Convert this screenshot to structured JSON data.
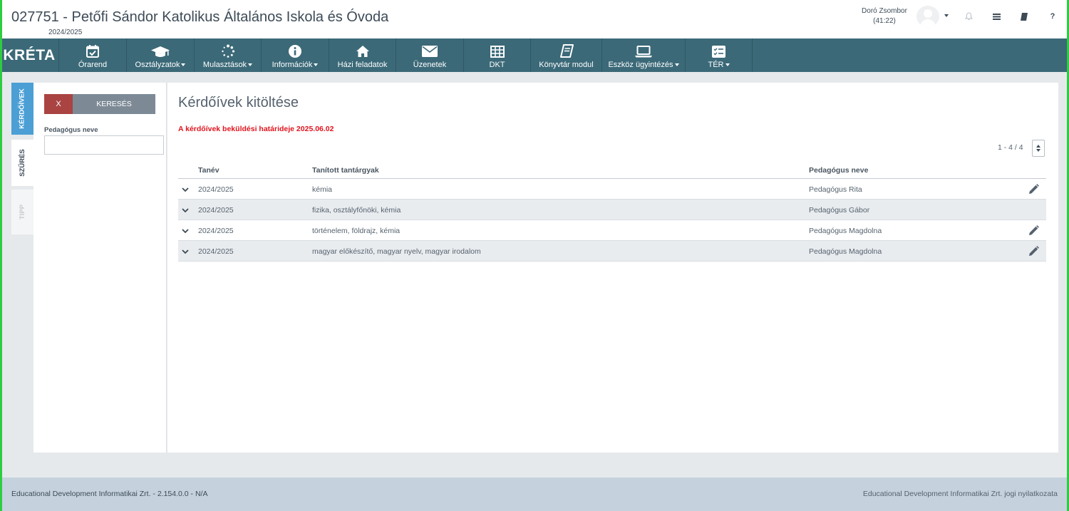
{
  "header": {
    "school_title": "027751 - Petőfi Sándor Katolikus Általános Iskola és Óvoda",
    "year": "2024/2025",
    "user_name": "Doró Zsombor",
    "session_timer": "(41:22)",
    "icons": [
      "bell-icon",
      "list-icon",
      "book-icon",
      "help-icon"
    ],
    "help_label": "?"
  },
  "nav": {
    "logo": "KRÉTA",
    "items": [
      {
        "label": "Órarend",
        "icon": "calendar-check-icon",
        "dropdown": false
      },
      {
        "label": "Osztályzatok",
        "icon": "graduation-cap-icon",
        "dropdown": true
      },
      {
        "label": "Mulasztások",
        "icon": "spinner-icon",
        "dropdown": true
      },
      {
        "label": "Információk",
        "icon": "info-icon",
        "dropdown": true
      },
      {
        "label": "Házi feladatok",
        "icon": "home-icon",
        "dropdown": false
      },
      {
        "label": "Üzenetek",
        "icon": "envelope-icon",
        "dropdown": false
      },
      {
        "label": "DKT",
        "icon": "table-icon",
        "dropdown": false
      },
      {
        "label": "Könyvtár modul",
        "icon": "book-icon",
        "dropdown": false
      },
      {
        "label": "Eszköz ügyintézés",
        "icon": "laptop-icon",
        "dropdown": true
      },
      {
        "label": "TÉR",
        "icon": "checklist-icon",
        "dropdown": true
      }
    ],
    "colors": {
      "nav_bg": "#3b6978"
    }
  },
  "side_tabs": {
    "kerdoivek": "KÉRDŐÍVEK",
    "szures": "SZŰRÉS",
    "tipp": "TIPP"
  },
  "filter": {
    "clear_label": "X",
    "search_label": "KERESÉS",
    "teacher_label": "Pedagógus neve",
    "teacher_value": ""
  },
  "main": {
    "title": "Kérdőívek kitöltése",
    "deadline": "A kérdőívek beküldési határideje 2025.06.02",
    "pager": "1 - 4 / 4",
    "columns": {
      "year": "Tanév",
      "subjects": "Tanított tantárgyak",
      "teacher": "Pedagógus neve"
    },
    "rows": [
      {
        "year": "2024/2025",
        "subjects": "kémia",
        "teacher": "Pedagógus Rita",
        "editable": true
      },
      {
        "year": "2024/2025",
        "subjects": "fizika, osztályfőnöki, kémia",
        "teacher": "Pedagógus Gábor",
        "editable": false
      },
      {
        "year": "2024/2025",
        "subjects": "történelem, földrajz, kémia",
        "teacher": "Pedagógus Magdolna",
        "editable": true
      },
      {
        "year": "2024/2025",
        "subjects": "magyar előkészítő, magyar nyelv, magyar irodalom",
        "teacher": "Pedagógus Magdolna",
        "editable": true
      }
    ]
  },
  "footer": {
    "left": "Educational Development Informatikai Zrt. - 2.154.0.0 - N/A",
    "right": "Educational Development Informatikai Zrt. jogi nyilatkozata"
  }
}
